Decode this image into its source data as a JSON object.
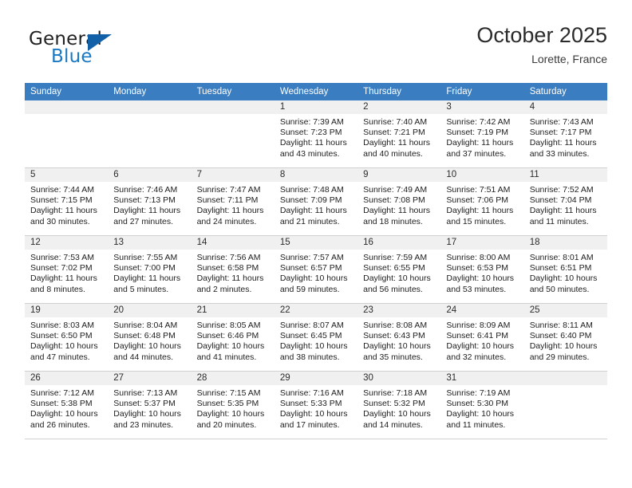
{
  "brand": {
    "word1": "General",
    "word2": "Blue",
    "accent_color": "#1878c4",
    "triangle_color": "#1160a8"
  },
  "header": {
    "title": "October 2025",
    "location": "Lorette, France"
  },
  "theme": {
    "header_bg": "#3a7dc0",
    "daynum_band_bg": "#f0f0f0",
    "grid_line": "#d0d0d0"
  },
  "weekday_headers": [
    "Sunday",
    "Monday",
    "Tuesday",
    "Wednesday",
    "Thursday",
    "Friday",
    "Saturday"
  ],
  "weeks": [
    [
      {
        "day": "",
        "lines": []
      },
      {
        "day": "",
        "lines": []
      },
      {
        "day": "",
        "lines": []
      },
      {
        "day": "1",
        "lines": [
          "Sunrise: 7:39 AM",
          "Sunset: 7:23 PM",
          "Daylight: 11 hours",
          "and 43 minutes."
        ]
      },
      {
        "day": "2",
        "lines": [
          "Sunrise: 7:40 AM",
          "Sunset: 7:21 PM",
          "Daylight: 11 hours",
          "and 40 minutes."
        ]
      },
      {
        "day": "3",
        "lines": [
          "Sunrise: 7:42 AM",
          "Sunset: 7:19 PM",
          "Daylight: 11 hours",
          "and 37 minutes."
        ]
      },
      {
        "day": "4",
        "lines": [
          "Sunrise: 7:43 AM",
          "Sunset: 7:17 PM",
          "Daylight: 11 hours",
          "and 33 minutes."
        ]
      }
    ],
    [
      {
        "day": "5",
        "lines": [
          "Sunrise: 7:44 AM",
          "Sunset: 7:15 PM",
          "Daylight: 11 hours",
          "and 30 minutes."
        ]
      },
      {
        "day": "6",
        "lines": [
          "Sunrise: 7:46 AM",
          "Sunset: 7:13 PM",
          "Daylight: 11 hours",
          "and 27 minutes."
        ]
      },
      {
        "day": "7",
        "lines": [
          "Sunrise: 7:47 AM",
          "Sunset: 7:11 PM",
          "Daylight: 11 hours",
          "and 24 minutes."
        ]
      },
      {
        "day": "8",
        "lines": [
          "Sunrise: 7:48 AM",
          "Sunset: 7:09 PM",
          "Daylight: 11 hours",
          "and 21 minutes."
        ]
      },
      {
        "day": "9",
        "lines": [
          "Sunrise: 7:49 AM",
          "Sunset: 7:08 PM",
          "Daylight: 11 hours",
          "and 18 minutes."
        ]
      },
      {
        "day": "10",
        "lines": [
          "Sunrise: 7:51 AM",
          "Sunset: 7:06 PM",
          "Daylight: 11 hours",
          "and 15 minutes."
        ]
      },
      {
        "day": "11",
        "lines": [
          "Sunrise: 7:52 AM",
          "Sunset: 7:04 PM",
          "Daylight: 11 hours",
          "and 11 minutes."
        ]
      }
    ],
    [
      {
        "day": "12",
        "lines": [
          "Sunrise: 7:53 AM",
          "Sunset: 7:02 PM",
          "Daylight: 11 hours",
          "and 8 minutes."
        ]
      },
      {
        "day": "13",
        "lines": [
          "Sunrise: 7:55 AM",
          "Sunset: 7:00 PM",
          "Daylight: 11 hours",
          "and 5 minutes."
        ]
      },
      {
        "day": "14",
        "lines": [
          "Sunrise: 7:56 AM",
          "Sunset: 6:58 PM",
          "Daylight: 11 hours",
          "and 2 minutes."
        ]
      },
      {
        "day": "15",
        "lines": [
          "Sunrise: 7:57 AM",
          "Sunset: 6:57 PM",
          "Daylight: 10 hours",
          "and 59 minutes."
        ]
      },
      {
        "day": "16",
        "lines": [
          "Sunrise: 7:59 AM",
          "Sunset: 6:55 PM",
          "Daylight: 10 hours",
          "and 56 minutes."
        ]
      },
      {
        "day": "17",
        "lines": [
          "Sunrise: 8:00 AM",
          "Sunset: 6:53 PM",
          "Daylight: 10 hours",
          "and 53 minutes."
        ]
      },
      {
        "day": "18",
        "lines": [
          "Sunrise: 8:01 AM",
          "Sunset: 6:51 PM",
          "Daylight: 10 hours",
          "and 50 minutes."
        ]
      }
    ],
    [
      {
        "day": "19",
        "lines": [
          "Sunrise: 8:03 AM",
          "Sunset: 6:50 PM",
          "Daylight: 10 hours",
          "and 47 minutes."
        ]
      },
      {
        "day": "20",
        "lines": [
          "Sunrise: 8:04 AM",
          "Sunset: 6:48 PM",
          "Daylight: 10 hours",
          "and 44 minutes."
        ]
      },
      {
        "day": "21",
        "lines": [
          "Sunrise: 8:05 AM",
          "Sunset: 6:46 PM",
          "Daylight: 10 hours",
          "and 41 minutes."
        ]
      },
      {
        "day": "22",
        "lines": [
          "Sunrise: 8:07 AM",
          "Sunset: 6:45 PM",
          "Daylight: 10 hours",
          "and 38 minutes."
        ]
      },
      {
        "day": "23",
        "lines": [
          "Sunrise: 8:08 AM",
          "Sunset: 6:43 PM",
          "Daylight: 10 hours",
          "and 35 minutes."
        ]
      },
      {
        "day": "24",
        "lines": [
          "Sunrise: 8:09 AM",
          "Sunset: 6:41 PM",
          "Daylight: 10 hours",
          "and 32 minutes."
        ]
      },
      {
        "day": "25",
        "lines": [
          "Sunrise: 8:11 AM",
          "Sunset: 6:40 PM",
          "Daylight: 10 hours",
          "and 29 minutes."
        ]
      }
    ],
    [
      {
        "day": "26",
        "lines": [
          "Sunrise: 7:12 AM",
          "Sunset: 5:38 PM",
          "Daylight: 10 hours",
          "and 26 minutes."
        ]
      },
      {
        "day": "27",
        "lines": [
          "Sunrise: 7:13 AM",
          "Sunset: 5:37 PM",
          "Daylight: 10 hours",
          "and 23 minutes."
        ]
      },
      {
        "day": "28",
        "lines": [
          "Sunrise: 7:15 AM",
          "Sunset: 5:35 PM",
          "Daylight: 10 hours",
          "and 20 minutes."
        ]
      },
      {
        "day": "29",
        "lines": [
          "Sunrise: 7:16 AM",
          "Sunset: 5:33 PM",
          "Daylight: 10 hours",
          "and 17 minutes."
        ]
      },
      {
        "day": "30",
        "lines": [
          "Sunrise: 7:18 AM",
          "Sunset: 5:32 PM",
          "Daylight: 10 hours",
          "and 14 minutes."
        ]
      },
      {
        "day": "31",
        "lines": [
          "Sunrise: 7:19 AM",
          "Sunset: 5:30 PM",
          "Daylight: 10 hours",
          "and 11 minutes."
        ]
      },
      {
        "day": "",
        "lines": []
      }
    ]
  ]
}
